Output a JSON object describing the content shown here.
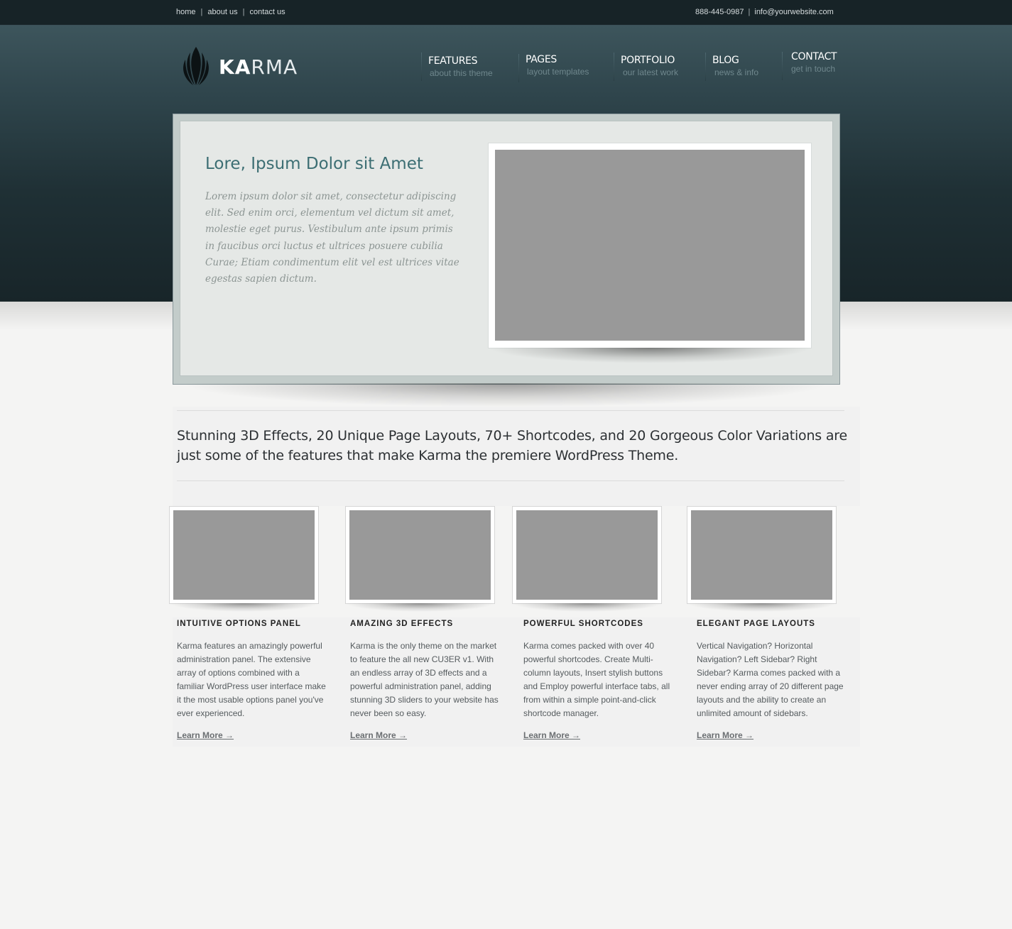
{
  "topbar": {
    "links": [
      "home",
      "about us",
      "contact us"
    ],
    "phone": "888-445-0987",
    "email": "info@yourwebsite.com"
  },
  "logo": {
    "text_bold": "KA",
    "text_light": "RMA",
    "icon": "lotus-leaf-logo-icon"
  },
  "nav": [
    {
      "title": "FEATURES",
      "subtitle": "about this theme"
    },
    {
      "title": "PAGES",
      "subtitle": "layout templates"
    },
    {
      "title": "PORTFOLIO",
      "subtitle": "our latest work"
    },
    {
      "title": "BLOG",
      "subtitle": "news & info"
    },
    {
      "title": "CONTACT",
      "subtitle": "get in touch"
    }
  ],
  "slider": {
    "title": "Lore, Ipsum Dolor sit Amet",
    "text": "Lorem ipsum dolor sit amet, consectetur adipiscing elit. Sed enim orci, elementum vel dictum sit amet, molestie eget purus. Vestibulum ante ipsum primis in faucibus orci luctus et ultrices posuere cubilia Curae; Etiam condimentum elit vel est ultrices vitae egestas sapien dictum."
  },
  "tagline": "Stunning 3D Effects, 20 Unique Page Layouts, 70+ Shortcodes, and 20 Gorgeous Color Variations are just some of the features that make Karma the premiere WordPress Theme.",
  "features": [
    {
      "title": "INTUITIVE OPTIONS PANEL",
      "text": "Karma features an amazingly powerful administration panel. The extensive array of options combined with a familiar WordPress user interface make it the most usable options panel you've ever experienced.",
      "link": "Learn More →"
    },
    {
      "title": "AMAZING 3D EFFECTS",
      "text": "Karma is the only theme on the market to feature the all new CU3ER v1. With an endless array of 3D effects and a powerful administration panel, adding stunning 3D sliders to your website has never been so easy.",
      "link": "Learn More →"
    },
    {
      "title": "POWERFUL SHORTCODES",
      "text": "Karma comes packed with over 40 powerful shortcodes. Create Multi-column layouts, Insert stylish buttons and Employ powerful interface tabs, all from within a simple point-and-click shortcode manager.",
      "link": "Learn More →"
    },
    {
      "title": "ELEGANT PAGE LAYOUTS",
      "text": "Vertical Navigation? Horizontal Navigation? Left Sidebar? Right Sidebar? Karma comes packed with a never ending array of 20 different page layouts and the ability to create an unlimited amount of sidebars.",
      "link": "Learn More →"
    }
  ],
  "colors": {
    "header_dark": "#172327",
    "accent_title": "#3c6e73",
    "image_placeholder": "#999999"
  }
}
